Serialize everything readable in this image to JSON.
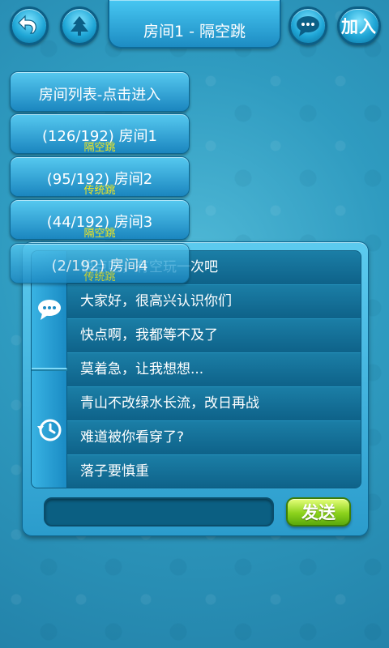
{
  "header": {
    "title": "房间1 - 隔空跳",
    "back_icon": "back-arrow-icon",
    "home_icon": "tree-icon",
    "chat_icon": "chat-bubble-icon",
    "join_label": "加入"
  },
  "rooms": {
    "header_label": "房间列表-点击进入",
    "items": [
      {
        "label": "(126/192) 房间1",
        "mode": "隔空跳"
      },
      {
        "label": "(95/192) 房间2",
        "mode": "传统跳"
      },
      {
        "label": "(44/192) 房间3",
        "mode": "隔空跳"
      },
      {
        "label": "(2/192) 房间4",
        "mode": "传统跳"
      }
    ]
  },
  "chat": {
    "tabs": [
      "chat-bubble-icon",
      "history-clock-icon"
    ],
    "messages": [
      "快点吧，有空玩一次吧",
      "大家好，很高兴认识你们",
      "快点啊，我都等不及了",
      "莫着急，让我想想...",
      "青山不改绿水长流，改日再战",
      "难道被你看穿了?",
      "落子要慎重"
    ],
    "input_value": "",
    "send_label": "发送"
  },
  "colors": {
    "accent": "#1fa6d6",
    "mode_text": "#f4e81c",
    "send_green": "#8cd21c"
  }
}
